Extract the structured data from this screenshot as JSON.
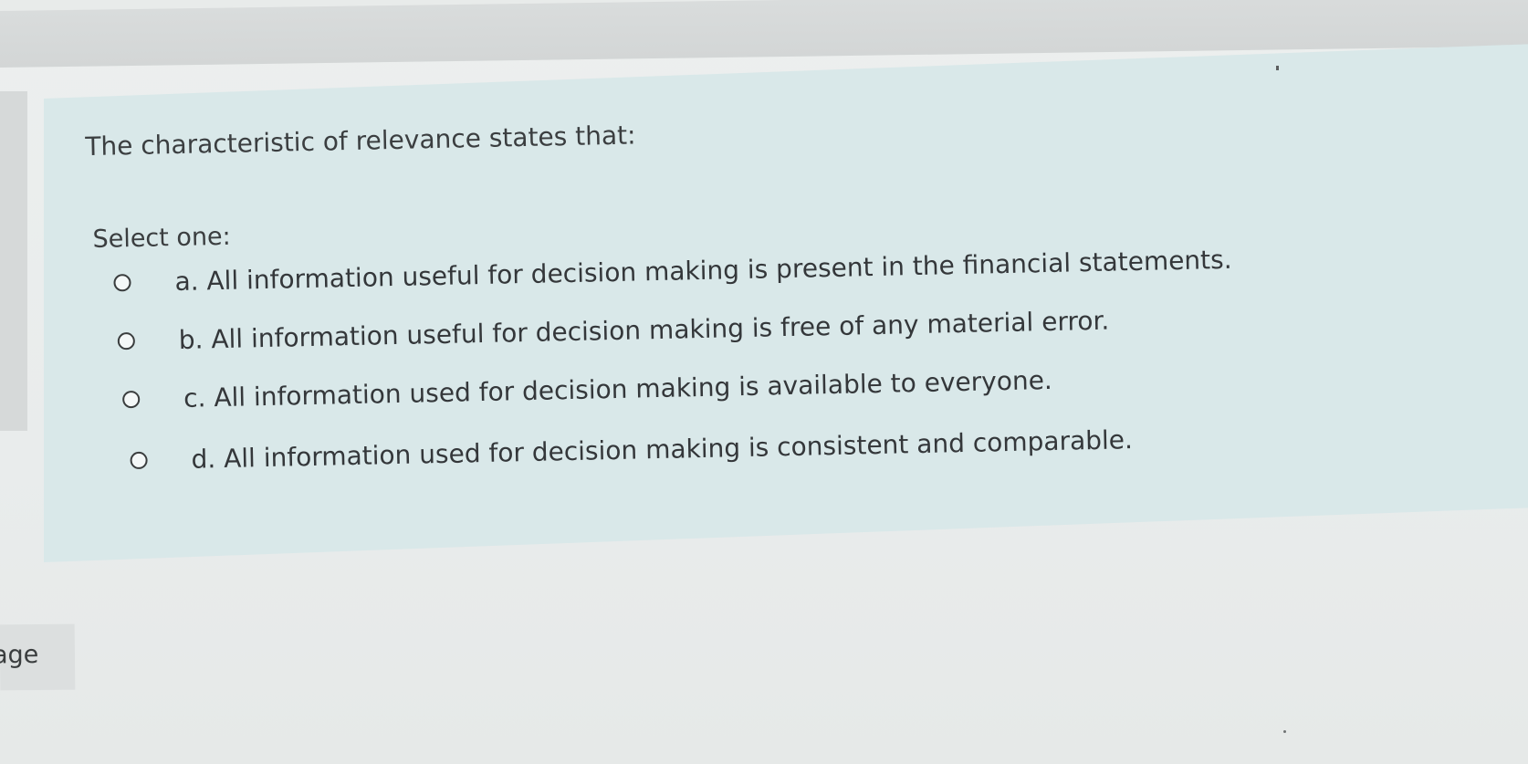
{
  "question": {
    "text": "The characteristic of relevance states that:",
    "instruction": "Select one:",
    "options": [
      {
        "label": "a. All information useful for decision making is present in the financial statements.",
        "selected": false
      },
      {
        "label": "b. All information useful for decision making is free of any material error.",
        "selected": false
      },
      {
        "label": "c. All information used for decision making is available to everyone.",
        "selected": false
      },
      {
        "label": "d. All information used for decision making is consistent and comparable.",
        "selected": false
      }
    ]
  },
  "navigation": {
    "page_tab_label": "age"
  },
  "colors": {
    "question_background": "#d9e8e9",
    "page_background": "#ecefee",
    "text": "#3b3e40"
  }
}
